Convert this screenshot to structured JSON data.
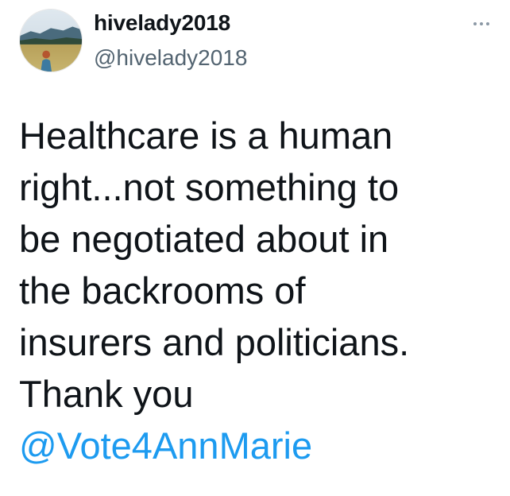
{
  "tweet": {
    "display_name": "hivelady2018",
    "handle": "@hivelady2018",
    "avatar_icon": "profile-photo-landscape",
    "more_icon": "more-options-icon",
    "text_lines": [
      "Healthcare is a human",
      "right...not something to",
      "be negotiated about in",
      "the backrooms of",
      "insurers and politicians.",
      "Thank you"
    ],
    "mention": "@Vote4AnnMarie"
  },
  "colors": {
    "text": "#0f1419",
    "secondary": "#536471",
    "link": "#1d9bf0"
  }
}
